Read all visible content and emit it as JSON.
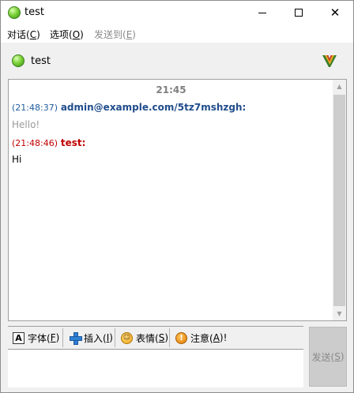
{
  "window": {
    "title": "test",
    "status": "online"
  },
  "menubar": {
    "items": [
      {
        "label": "对话(",
        "accel": "C",
        "tail": ")"
      },
      {
        "label": "选项(",
        "accel": "O",
        "tail": ")"
      },
      {
        "label": "发送到(",
        "accel": "E",
        "tail": ")",
        "disabled": true
      }
    ]
  },
  "contact": {
    "name": "test",
    "vcard_icon": "vcard-icon"
  },
  "chat": {
    "time_separator": "21:45",
    "messages": [
      {
        "timestamp": "(21:48:37)",
        "nick": "admin@example.com/5tz7mshzgh:",
        "body": "Hello!",
        "direction": "incoming"
      },
      {
        "timestamp": "(21:48:46)",
        "nick": "test:",
        "body": "Hi",
        "direction": "outgoing"
      }
    ]
  },
  "toolbar": {
    "font": {
      "label": "字体(",
      "accel": "F",
      "tail": ")"
    },
    "insert": {
      "label": "插入(",
      "accel": "I",
      "tail": ")"
    },
    "emote": {
      "label": "表情(",
      "accel": "S",
      "tail": ")"
    },
    "notice": {
      "label": "注意(",
      "accel": "A",
      "tail": ")!"
    }
  },
  "send": {
    "label": "发送(",
    "accel": "S",
    "tail": ")",
    "enabled": false
  },
  "colors": {
    "remote_nick": "#214d8c",
    "local_nick": "#c00000",
    "status_online": "#7ed23a"
  }
}
